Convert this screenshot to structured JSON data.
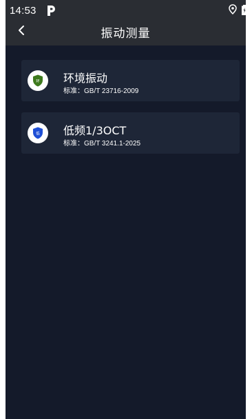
{
  "status_bar": {
    "time": "14:53",
    "notification_icon": "p-icon",
    "location_icon": "location-pin-icon",
    "battery_icon": "battery-icon"
  },
  "app_bar": {
    "back_icon": "chevron-left-icon",
    "title": "振动测量"
  },
  "items": [
    {
      "title": "环境振动",
      "standard": "标准：GB/T 23716-2009",
      "icon": "shield-icon",
      "badge_char": "环",
      "color": "#3e7a1e"
    },
    {
      "title": "低频1/3OCT",
      "standard": "标准：GB/T 3241.1-2025",
      "icon": "shield-icon",
      "badge_char": "低",
      "color": "#1f4fd6"
    }
  ],
  "colors": {
    "background": "#141a2a",
    "bar": "#2a2d33",
    "card": "#1e2637"
  }
}
